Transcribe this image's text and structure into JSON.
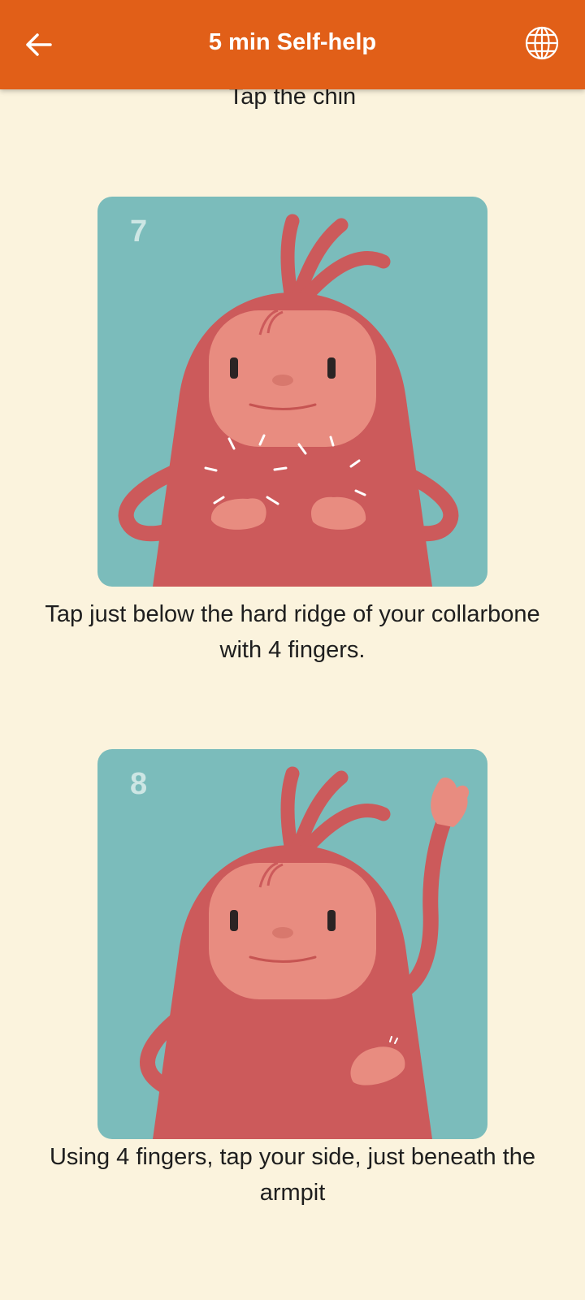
{
  "header": {
    "title": "5 min Self-help",
    "back_icon": "arrow-left-icon",
    "language_icon": "globe-icon",
    "background": "#E15F18"
  },
  "steps": [
    {
      "caption": "Tap the chin"
    },
    {
      "number": "7",
      "caption": "Tap just below the hard ridge of your collarbone with 4 fingers."
    },
    {
      "number": "8",
      "caption": "Using 4 fingers, tap your side, just beneath the armpit"
    }
  ],
  "colors": {
    "background": "#FBF3DD",
    "card": "#7BBCBB",
    "character_body": "#CC5A5B",
    "character_face": "#E88C80"
  }
}
